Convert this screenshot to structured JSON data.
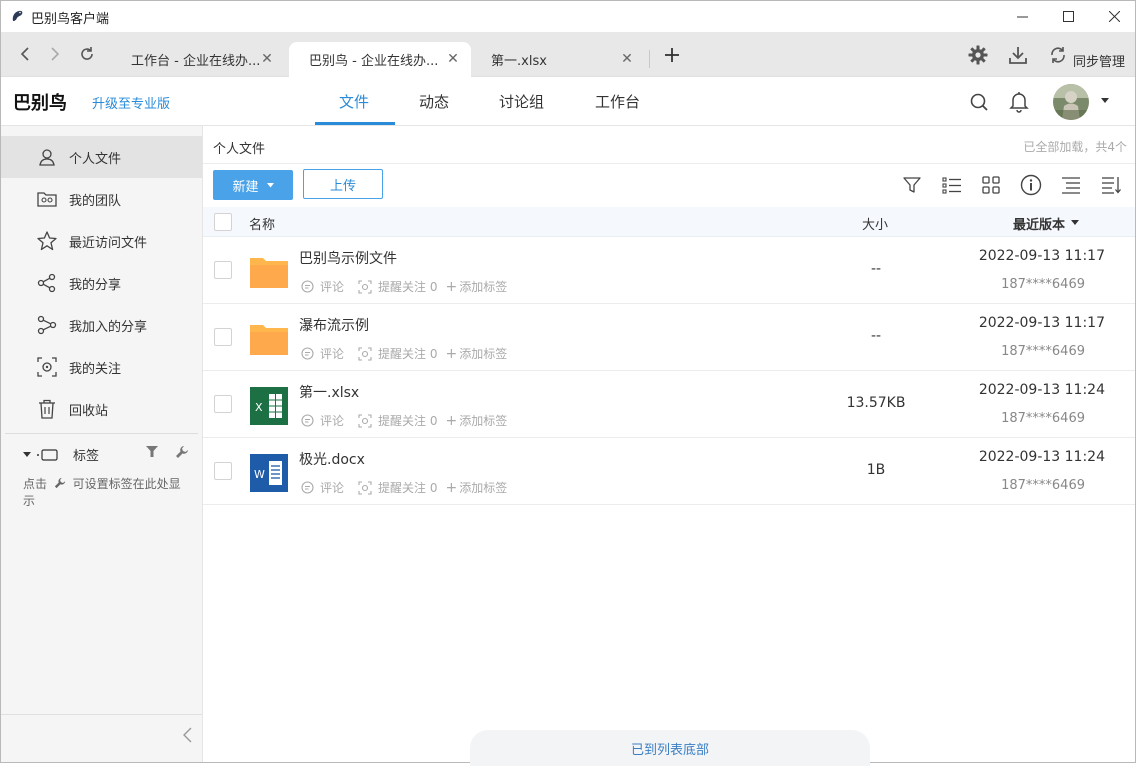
{
  "window": {
    "title": "巴别鸟客户端"
  },
  "tabs": [
    {
      "label": "工作台 - 企业在线办..."
    },
    {
      "label": "巴别鸟 - 企业在线办..."
    },
    {
      "label": "第一.xlsx"
    }
  ],
  "tabbar": {
    "sync_label": "同步管理"
  },
  "header": {
    "brand": "巴别鸟",
    "upgrade": "升级至专业版",
    "nav": [
      "文件",
      "动态",
      "讨论组",
      "工作台"
    ]
  },
  "sidebar": {
    "items": [
      {
        "label": "个人文件",
        "icon": "user-icon"
      },
      {
        "label": "我的团队",
        "icon": "team-folder-icon"
      },
      {
        "label": "最近访问文件",
        "icon": "star-icon"
      },
      {
        "label": "我的分享",
        "icon": "share-icon"
      },
      {
        "label": "我加入的分享",
        "icon": "joined-share-icon"
      },
      {
        "label": "我的关注",
        "icon": "focus-icon"
      },
      {
        "label": "回收站",
        "icon": "trash-icon"
      }
    ],
    "tags_label": "标签",
    "tags_help_prefix": "点击",
    "tags_help_suffix": "可设置标签在此处显示"
  },
  "main": {
    "breadcrumb": "个人文件",
    "loaded_info": "已全部加载，共4个",
    "new_button": "新建",
    "upload_button": "上传",
    "columns": {
      "name": "名称",
      "size": "大小",
      "version": "最近版本"
    },
    "actions": {
      "comment": "评论",
      "remind": "提醒关注 0",
      "add_tag": "添加标签"
    },
    "files": [
      {
        "name": "巴别鸟示例文件",
        "type": "folder",
        "size": "--",
        "date": "2022-09-13 11:17",
        "user": "187****6469"
      },
      {
        "name": "瀑布流示例",
        "type": "folder",
        "size": "--",
        "date": "2022-09-13 11:17",
        "user": "187****6469"
      },
      {
        "name": "第一.xlsx",
        "type": "excel",
        "size": "13.57KB",
        "date": "2022-09-13 11:24",
        "user": "187****6469"
      },
      {
        "name": "极光.docx",
        "type": "word",
        "size": "1B",
        "date": "2022-09-13 11:24",
        "user": "187****6469"
      }
    ],
    "end_of_list": "已到列表底部"
  },
  "colors": {
    "accent": "#2a8bd8",
    "new_button": "#4aa3e8",
    "folder": "#ffb74d",
    "excel": "#1d7044",
    "word": "#1e5ba8"
  }
}
